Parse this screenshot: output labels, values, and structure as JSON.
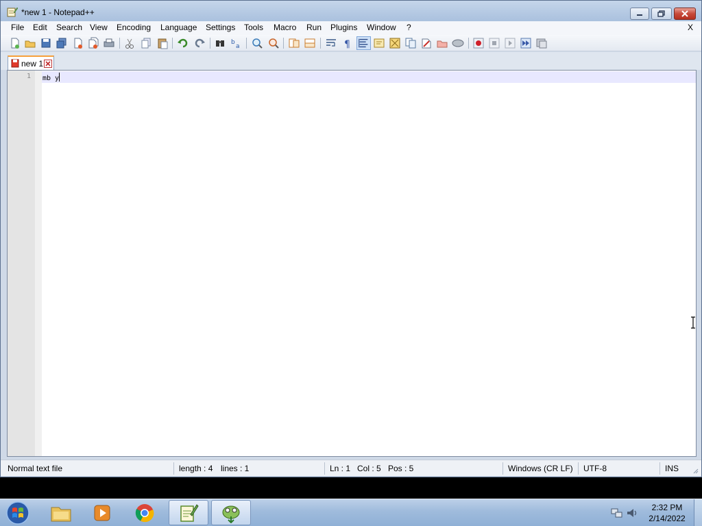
{
  "window": {
    "title": "*new 1 - Notepad++",
    "close_glyph": "✕",
    "maximize_glyph": "▢",
    "minimize_glyph": "▁"
  },
  "menubar": {
    "items": [
      "File",
      "Edit",
      "Search",
      "View",
      "Encoding",
      "Language",
      "Settings",
      "Tools",
      "Macro",
      "Run",
      "Plugins",
      "Window",
      "?"
    ],
    "close_label": "X"
  },
  "toolbar": {
    "icons": [
      "new-file-icon",
      "open-file-icon",
      "save-icon",
      "save-all-icon",
      "close-icon",
      "close-all-icon",
      "print-icon",
      "cut-icon",
      "copy-icon",
      "paste-icon",
      "undo-icon",
      "redo-icon",
      "find-icon",
      "replace-icon",
      "zoom-in-icon",
      "zoom-out-icon",
      "sync-vertical-icon",
      "sync-horizontal-icon",
      "word-wrap-icon",
      "show-all-characters-icon",
      "indent-guide-icon",
      "user-defined-language-icon",
      "document-map-icon",
      "function-list-icon",
      "folder-as-workspace-icon",
      "monitoring-icon",
      "record-macro-icon",
      "stop-recording-icon",
      "playback-macro-icon",
      "run-macro-multiple-icon",
      "save-macro-icon"
    ]
  },
  "tab": {
    "label": "new 1"
  },
  "editor": {
    "line_number": "1",
    "line_text": "mb y",
    "line_text_before_caret": "mb y"
  },
  "status": {
    "file_type": "Normal text file",
    "length": "length : 4",
    "lines": "lines : 1",
    "ln": "Ln : 1",
    "col": "Col : 5",
    "pos": "Pos : 5",
    "eol": "Windows (CR LF)",
    "encoding": "UTF-8",
    "mode": "INS"
  },
  "taskbar": {
    "apps": [
      "file-explorer-icon",
      "media-player-icon",
      "chrome-icon",
      "notepad-plus-plus-icon",
      "app-icon"
    ],
    "time": "2:32 PM",
    "date": "2/14/2022"
  },
  "colors": {
    "current_line": "#e8e8ff",
    "tab_accent": "#f6a03a",
    "close_button": "#c74a3a"
  }
}
